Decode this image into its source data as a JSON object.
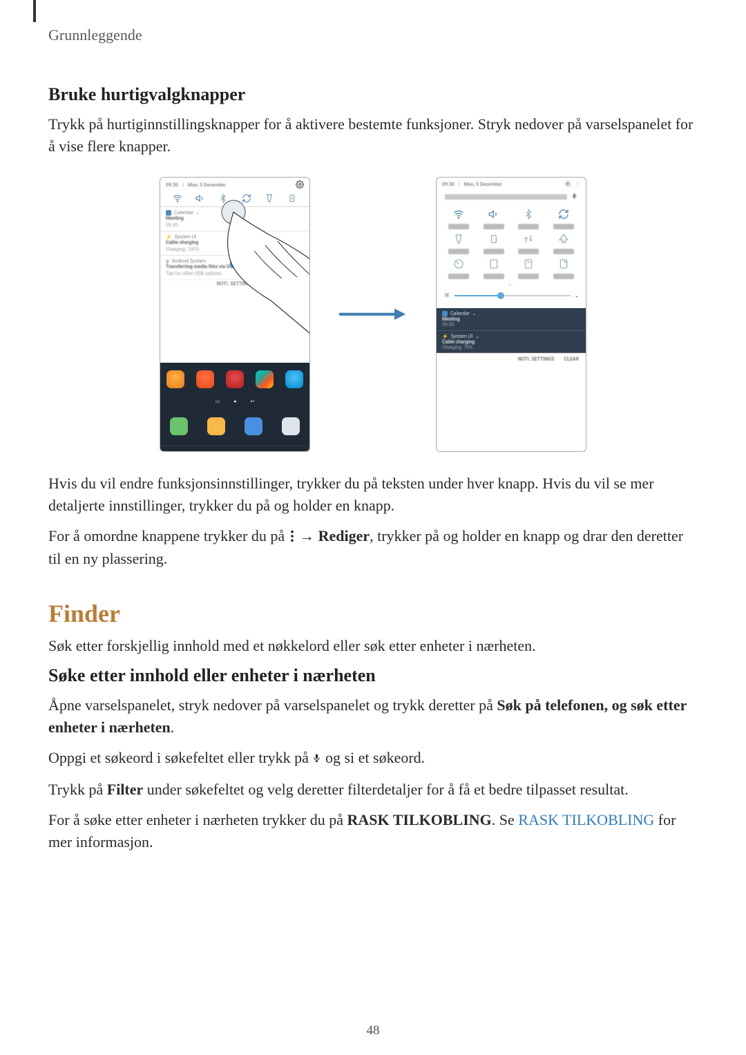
{
  "header": {
    "running": "Grunnleggende"
  },
  "section1": {
    "heading": "Bruke hurtigvalgknapper",
    "body": "Trykk på hurtiginnstillingsknapper for å aktivere bestemte funksjoner. Stryk nedover på varselspanelet for å vise flere knapper."
  },
  "para_after_figure1": "Hvis du vil endre funksjonsinnstillinger, trykker du på teksten under hver knapp. Hvis du vil se mer detaljerte innstillinger, trykker du på og holder en knapp.",
  "para_after_figure2_a": "For å omordne knappene trykker du på ",
  "para_after_figure2_b": "Rediger",
  "para_after_figure2_c": ", trykker på og holder en knapp og drar den deretter til en ny plassering.",
  "arrow_sep": " → ",
  "finder": {
    "title": "Finder",
    "intro": "Søk etter forskjellig innhold med et nøkkelord eller søk etter enheter i nærheten.",
    "sub_heading": "Søke etter innhold eller enheter i nærheten",
    "p1_a": "Åpne varselspanelet, stryk nedover på varselspanelet og trykk deretter på ",
    "p1_b": "Søk på telefonen, og søk etter enheter i nærheten",
    "p1_c": ".",
    "p2_a": "Oppgi et søkeord i søkefeltet eller trykk på ",
    "p2_b": " og si et søkeord.",
    "p3_a": "Trykk på ",
    "p3_b": "Filter",
    "p3_c": " under søkefeltet og velg deretter filterdetaljer for å få et bedre tilpasset resultat.",
    "p4_a": "For å søke etter enheter i nærheten trykker du på ",
    "p4_b": "RASK TILKOBLING",
    "p4_c": ". Se ",
    "p4_link": "RASK TILKOBLING",
    "p4_d": " for mer informasjon."
  },
  "page_number": "48",
  "phone_left": {
    "status_time": "09:30",
    "status_date": "Mon, 5 December",
    "notif1_app": "Calendar",
    "notif1_title": "Meeting",
    "notif1_time": "09:30",
    "notif2_app": "System UI",
    "notif2_title": "Cable charging",
    "notif2_sub": "Charging: 100%",
    "notif3_app": "Android System",
    "notif3_title": "Transferring media files via USB",
    "notif3_sub": "Tap for other USB options.",
    "footer": "NOTI. SETTINGS"
  },
  "phone_right": {
    "status_time": "09:30",
    "status_date": "Mon, 5 December",
    "search_placeholder": "Search phone and scan for nearby devices",
    "footer_left": "NOTI. SETTINGS",
    "footer_right": "CLEAR",
    "notif1_app": "Calendar",
    "notif1_title": "Meeting",
    "notif1_time": "09:30",
    "notif2_app": "System UI",
    "notif2_title": "Cable charging",
    "notif2_sub": "Charging: 70%"
  }
}
